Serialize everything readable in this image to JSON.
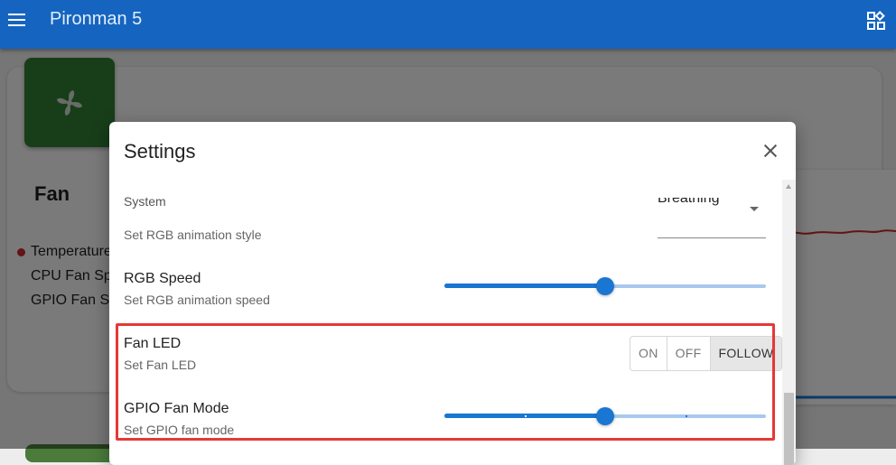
{
  "app": {
    "title": "Pironman 5"
  },
  "fan_card": {
    "heading": "Fan",
    "metrics": [
      "Temperature",
      "CPU Fan Sp",
      "GPIO Fan S"
    ]
  },
  "dialog": {
    "title": "Settings",
    "section_label": "System",
    "rgb_style": {
      "description": "Set RGB animation style",
      "selected": "Breathing"
    },
    "rgb_speed": {
      "label": "RGB Speed",
      "description": "Set RGB animation speed",
      "value_fraction": 0.5
    },
    "fan_led": {
      "label": "Fan LED",
      "description": "Set Fan LED",
      "options": [
        "ON",
        "OFF",
        "FOLLOW"
      ],
      "selected": "FOLLOW"
    },
    "gpio_fan_mode": {
      "label": "GPIO Fan Mode",
      "description": "Set GPIO fan mode",
      "value_fraction": 0.5,
      "steps": 4
    }
  },
  "colors": {
    "app_bar": "#1565c0",
    "accent": "#1976d2",
    "fan_tile": "#2e7d32",
    "highlight": "#e53935"
  }
}
